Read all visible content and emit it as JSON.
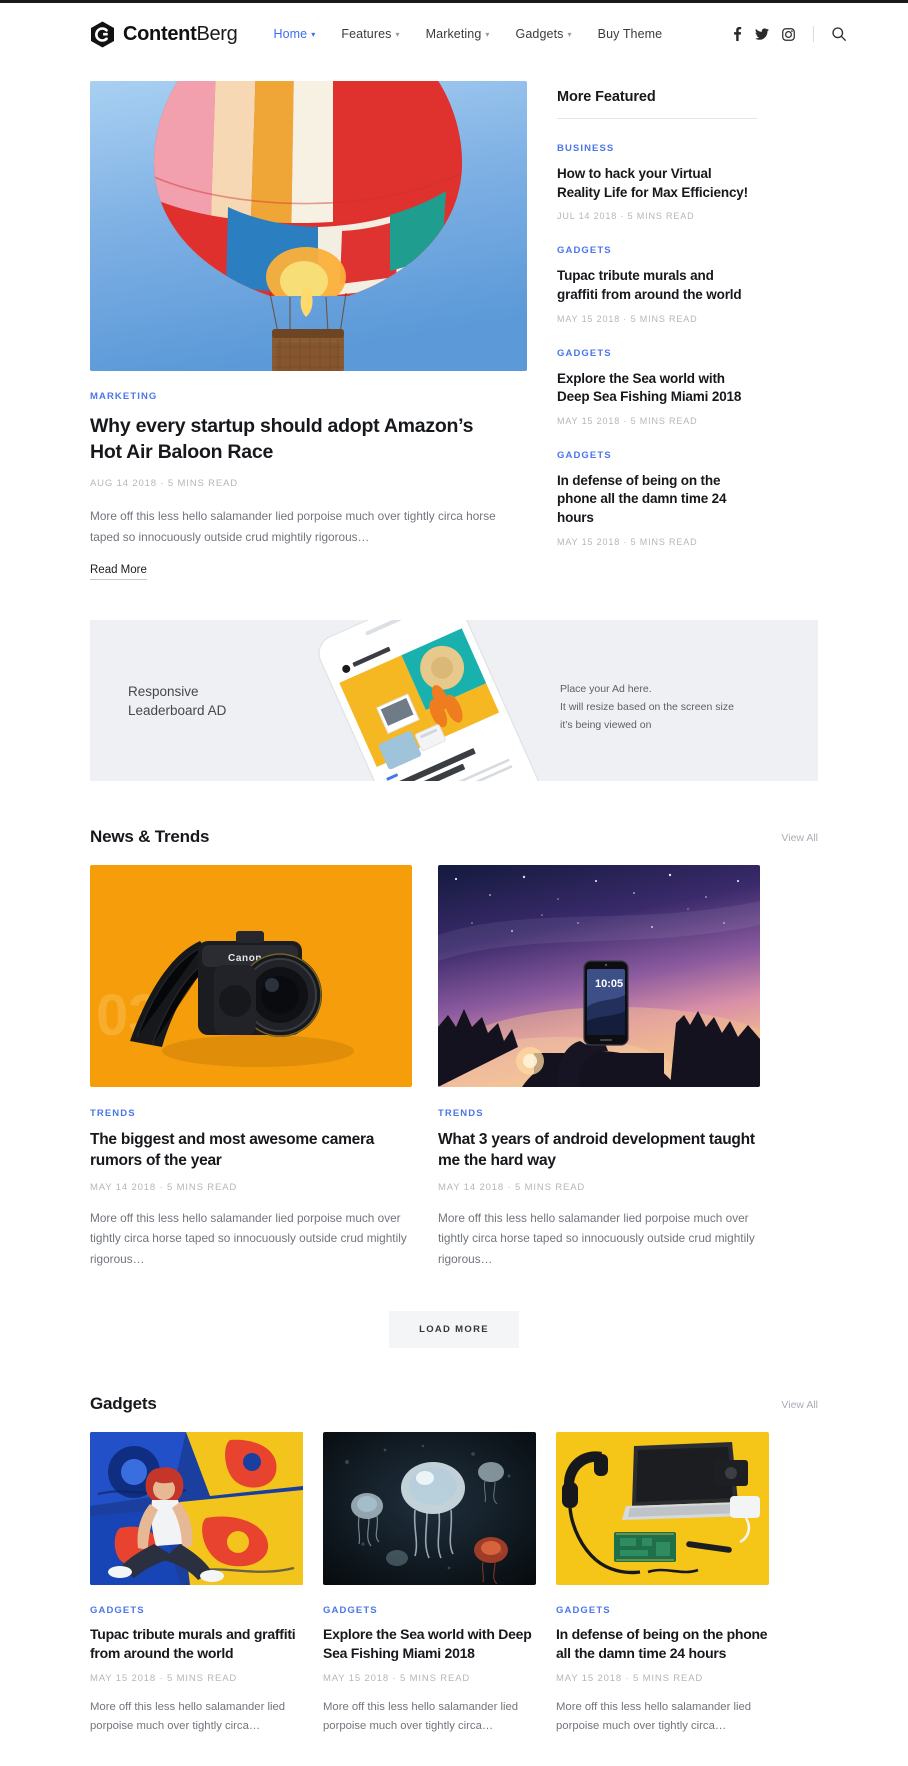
{
  "header": {
    "brand": {
      "bold": "Content",
      "regular": "Berg",
      "logo_icon": "hexagon-c-logo"
    },
    "nav": [
      {
        "label": "Home",
        "has_dropdown": true,
        "active": true
      },
      {
        "label": "Features",
        "has_dropdown": true,
        "active": false
      },
      {
        "label": "Marketing",
        "has_dropdown": true,
        "active": false
      },
      {
        "label": "Gadgets",
        "has_dropdown": true,
        "active": false
      },
      {
        "label": "Buy Theme",
        "has_dropdown": false,
        "active": false
      }
    ],
    "social": [
      {
        "name": "facebook-icon"
      },
      {
        "name": "twitter-icon"
      },
      {
        "name": "instagram-icon"
      }
    ],
    "search_icon": "search-icon"
  },
  "hero": {
    "image_alt": "hot-air-balloon",
    "category": "MARKETING",
    "title": "Why every startup should adopt Amazon’s Hot Air Baloon Race",
    "meta": "AUG 14 2018  ·  5 MINS READ",
    "excerpt": "More off this less hello salamander lied porpoise much over tightly circa horse taped so innocuously outside crud mightily rigorous…",
    "read_more": "Read More"
  },
  "sidebar": {
    "title": "More Featured",
    "items": [
      {
        "category": "BUSINESS",
        "title": "How to hack your Virtual Reality Life for Max Efficiency!",
        "meta": "JUL 14 2018  ·  5 MINS READ"
      },
      {
        "category": "GADGETS",
        "title": "Tupac tribute murals and graffiti from around the world",
        "meta": "MAY 15 2018  ·  5 MINS READ"
      },
      {
        "category": "GADGETS",
        "title": "Explore the Sea world with Deep Sea Fishing Miami 2018",
        "meta": "MAY 15 2018  ·  5 MINS READ"
      },
      {
        "category": "GADGETS",
        "title": "In defense of being on the phone all the damn time 24 hours",
        "meta": "MAY 15 2018  ·  5 MINS READ"
      }
    ]
  },
  "ad": {
    "left_line1": "Responsive",
    "left_line2": "Leaderboard AD",
    "right_line1": "Place your Ad here.",
    "right_line2": "It will resize based on the screen size",
    "right_line3": "it’s being viewed on",
    "phone_alt": "smartphone-mockup",
    "bg_color": "#eef0f3"
  },
  "news": {
    "section_title": "News & Trends",
    "view_all": "View All",
    "cards": [
      {
        "image_alt": "dslr-camera-on-orange",
        "category": "TRENDS",
        "title": "The biggest and most awesome camera rumors of the year",
        "meta": "MAY 14 2018  ·  5 MINS READ",
        "excerpt": "More off this less hello salamander lied porpoise much over tightly circa horse taped so innocuously outside crud mightily rigorous…"
      },
      {
        "image_alt": "phone-held-against-night-sky",
        "category": "TRENDS",
        "title": "What 3 years of android development taught me the hard way",
        "meta": "MAY 14 2018  ·  5 MINS READ",
        "excerpt": "More off this less hello salamander lied porpoise much over tightly circa horse taped so innocuously outside crud mightily rigorous…"
      }
    ],
    "load_more": "LOAD MORE"
  },
  "gadgets": {
    "section_title": "Gadgets",
    "view_all": "View All",
    "cards": [
      {
        "image_alt": "woman-sitting-in-front-of-graffiti-wall",
        "category": "GADGETS",
        "title": "Tupac tribute murals and graffiti from around the world",
        "meta": "MAY 15 2018  ·  5 MINS READ",
        "excerpt": "More off this less hello salamander lied porpoise much over tightly circa…"
      },
      {
        "image_alt": "jellyfish-underwater-dark",
        "category": "GADGETS",
        "title": "Explore the Sea world with Deep Sea Fishing Miami 2018",
        "meta": "MAY 15 2018  ·  5 MINS READ",
        "excerpt": "More off this less hello salamander lied porpoise much over tightly circa…"
      },
      {
        "image_alt": "laptop-headphones-flatlay-on-yellow",
        "category": "GADGETS",
        "title": "In defense of being on the phone all the damn time 24 hours",
        "meta": "MAY 15 2018  ·  5 MINS READ",
        "excerpt": "More off this less hello salamander lied porpoise much over tightly circa…"
      }
    ]
  },
  "colors": {
    "accent_blue": "#4a76e8",
    "nav_active": "#3c6ef0",
    "text_dark": "#16181c",
    "text_muted": "#71757c",
    "meta_gray": "#b3b6bb"
  }
}
